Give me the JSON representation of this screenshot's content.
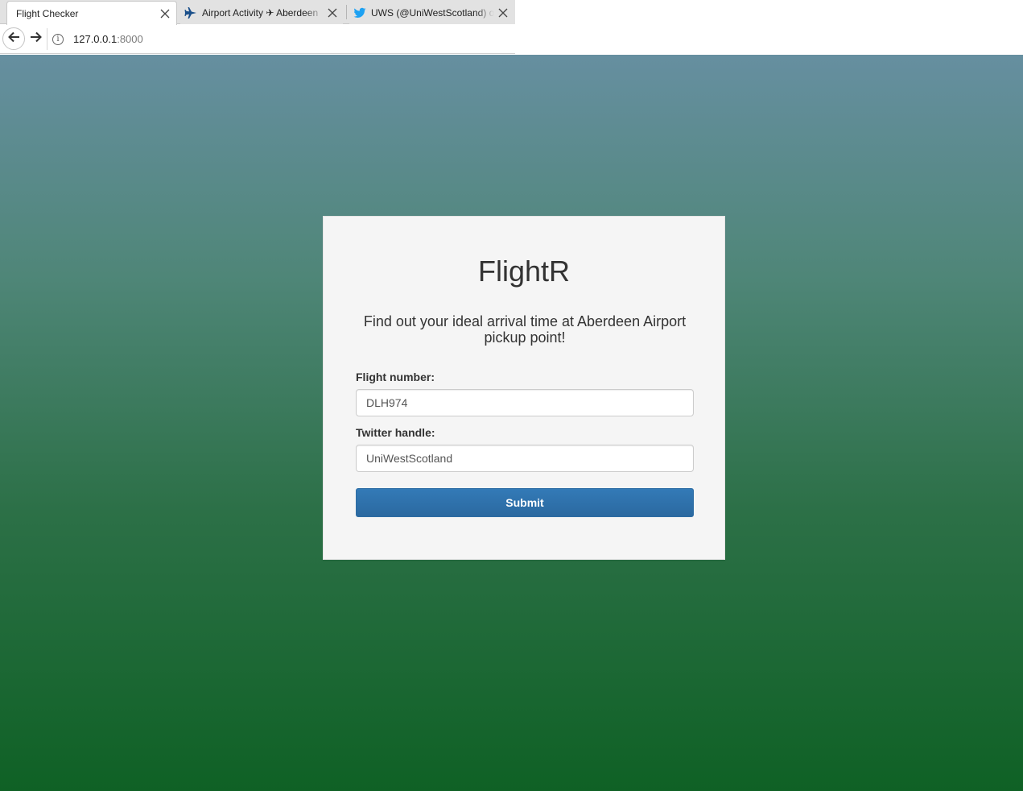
{
  "browser": {
    "tabs": [
      {
        "title": "Flight Checker",
        "active": true
      },
      {
        "title": "Airport Activity ✈ Aberdeen",
        "active": false
      },
      {
        "title": "UWS (@UniWestScotland) on",
        "active": false
      }
    ],
    "address": {
      "host": "127.0.0.1",
      "port": ":8000"
    },
    "info_glyph": "i"
  },
  "page": {
    "title": "FlightR",
    "tagline": "Find out your ideal arrival time at Aberdeen Airport pickup point!",
    "form": {
      "flight_label": "Flight number:",
      "flight_value": "DLH974",
      "twitter_label": "Twitter handle:",
      "twitter_value": "UniWestScotland",
      "submit_label": "Submit"
    }
  },
  "colors": {
    "gradient_top": "#668fa0",
    "gradient_bottom": "#0f6125",
    "button": "#337ab7",
    "card": "#f5f5f5",
    "twitter_blue": "#1da1f2",
    "plane_blue": "#1a4f8a"
  },
  "icons": [
    "close-icon",
    "airplane-icon",
    "twitter-bird-icon",
    "back-arrow-icon",
    "forward-arrow-icon",
    "info-icon"
  ]
}
